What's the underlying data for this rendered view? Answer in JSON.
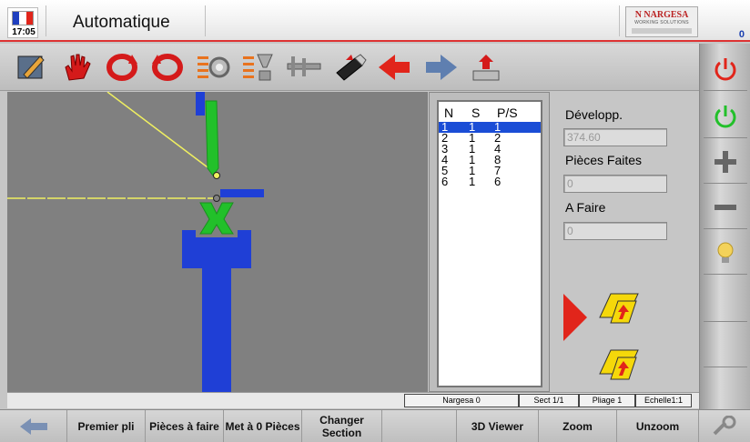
{
  "header": {
    "time": "17:05",
    "title": "Automatique",
    "logo_brand": "N NARGESA",
    "logo_tagline": "WORKING SOLUTIONS",
    "counter": "0"
  },
  "toolbar": {
    "icons": [
      "edit-icon",
      "hand-icon",
      "rotate-cw-icon",
      "rotate-ccw-icon",
      "gear-list-icon",
      "tooling-list-icon",
      "caliper-icon",
      "usb-icon",
      "arrow-left-icon",
      "arrow-right-icon",
      "import-icon"
    ]
  },
  "list": {
    "headers": [
      "N",
      "S",
      "P/S"
    ],
    "rows": [
      {
        "n": "1",
        "s": "1",
        "ps": "1"
      },
      {
        "n": "2",
        "s": "1",
        "ps": "2"
      },
      {
        "n": "3",
        "s": "1",
        "ps": "4"
      },
      {
        "n": "4",
        "s": "1",
        "ps": "8"
      },
      {
        "n": "5",
        "s": "1",
        "ps": "7"
      },
      {
        "n": "6",
        "s": "1",
        "ps": "6"
      }
    ],
    "selected_index": 0
  },
  "info": {
    "dev_label": "Développ.",
    "dev_value": "374.60",
    "done_label": "Pièces Faites",
    "done_value": "0",
    "todo_label": "A Faire",
    "todo_value": "0"
  },
  "status": {
    "name": "Nargesa 0",
    "sect": "Sect  1/1",
    "pliage": "Pliage 1",
    "echelle": "Echelle1:1"
  },
  "bottom": {
    "premier_pli": "Premier pli",
    "pieces_a_faire": "Pièces à faire",
    "met_a_0": "Met à 0 Pièces",
    "changer_section": "Changer Section",
    "viewer_3d": "3D Viewer",
    "zoom": "Zoom",
    "unzoom": "Unzoom"
  },
  "colors": {
    "accent_red": "#e1251b",
    "selection_blue": "#1a4dd6",
    "tool_green": "#22c02a",
    "machine_blue": "#1f3fd6"
  }
}
